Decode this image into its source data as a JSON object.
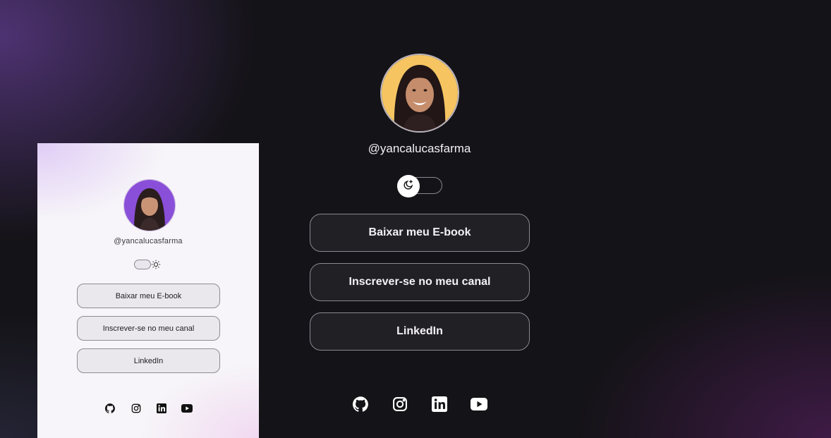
{
  "preview": {
    "handle": "@yancalucasfarma",
    "theme_toggle": {
      "state": "light",
      "icon": "sun-icon"
    },
    "buttons": [
      {
        "label": "Baixar meu E-book"
      },
      {
        "label": "Inscrever-se no meu canal"
      },
      {
        "label": "LinkedIn"
      }
    ],
    "social_icons": [
      "github-icon",
      "instagram-icon",
      "linkedin-icon",
      "youtube-icon"
    ]
  },
  "main": {
    "handle": "@yancalucasfarma",
    "theme_toggle": {
      "state": "dark",
      "icon": "moon-icon"
    },
    "buttons": [
      {
        "label": "Baixar meu E-book"
      },
      {
        "label": "Inscrever-se no meu canal"
      },
      {
        "label": "LinkedIn"
      }
    ],
    "social_icons": [
      "github-icon",
      "instagram-icon",
      "linkedin-icon",
      "youtube-icon"
    ]
  },
  "colors": {
    "background_dark": "#141317",
    "accent_purple": "#8a4fd8",
    "avatar_bg_main": "#f6c562",
    "text_light": "#f4f2f6",
    "text_dark": "#1d1d21"
  }
}
